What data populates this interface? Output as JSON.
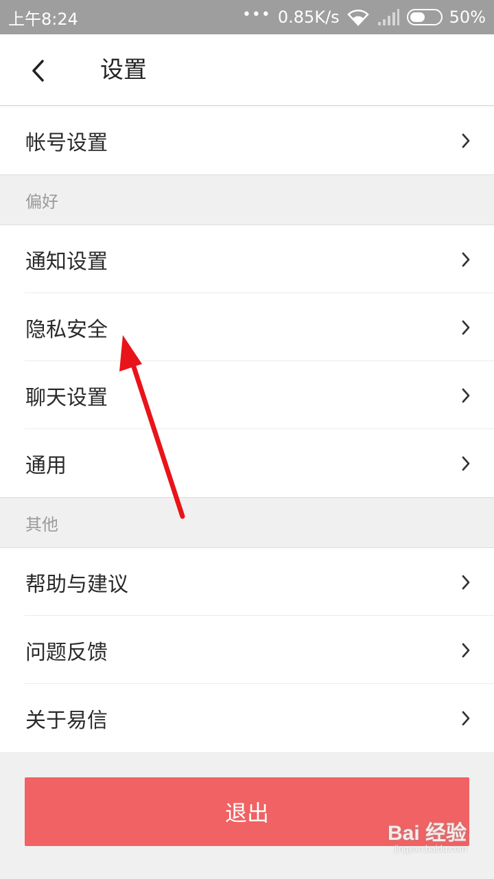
{
  "status_bar": {
    "time": "上午8:24",
    "dots": "•••",
    "network_speed": "0.85K/s",
    "battery_percent": "50%",
    "battery_level": 0.5,
    "icons": [
      "wifi-icon",
      "signal-icon",
      "battery-icon"
    ]
  },
  "header": {
    "title": "设置",
    "back_icon": "chevron-left-icon"
  },
  "rows": {
    "account": "帐号设置",
    "notifications": "通知设置",
    "privacy": "隐私安全",
    "chat": "聊天设置",
    "general": "通用",
    "help": "帮助与建议",
    "feedback": "问题反馈",
    "about": "关于易信"
  },
  "sections": {
    "preferences": "偏好",
    "others": "其他"
  },
  "logout": {
    "label": "退出",
    "color": "#f06263"
  },
  "annotation": {
    "arrow_color": "#e8141a"
  },
  "watermark": {
    "brand": "Bai 经验",
    "url": "jingyan.baidu.com"
  }
}
